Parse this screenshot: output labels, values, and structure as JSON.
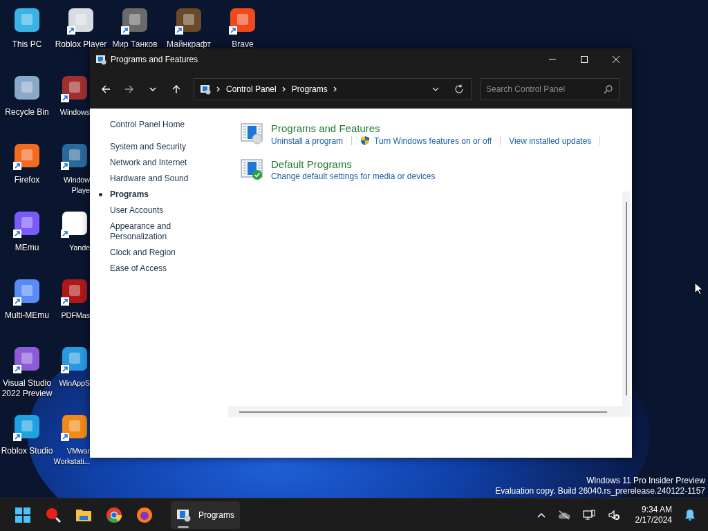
{
  "desktop": {
    "top_row": [
      {
        "label": "Мир Танков"
      },
      {
        "label": "Майнкрафт"
      },
      {
        "label": "Brave"
      }
    ],
    "icon_columns": [
      [
        {
          "label": "This PC"
        },
        {
          "label": "Recycle Bin"
        },
        {
          "label": "Firefox"
        },
        {
          "label": "MEmu"
        },
        {
          "label": "Multi-MEmu"
        },
        {
          "label": "Visual Studio 2022 Preview"
        },
        {
          "label": "Roblox Studio"
        }
      ],
      [
        {
          "label": "Roblox Player"
        },
        {
          "label": "Windows"
        },
        {
          "label": "Window Playe"
        },
        {
          "label": "Yande"
        },
        {
          "label": "PDFMas"
        },
        {
          "label": "WinAppS"
        },
        {
          "label": "VMwar Workstati..."
        }
      ]
    ],
    "watermark": [
      "Windows 11 Pro Insider Preview",
      "Evaluation copy. Build 26040.rs_prerelease.240122-1157"
    ]
  },
  "window": {
    "title": "Programs and Features",
    "breadcrumb": [
      "Control Panel",
      "Programs"
    ],
    "search": {
      "placeholder": "Search Control Panel"
    },
    "sidebar": {
      "home": "Control Panel Home",
      "items": [
        {
          "label": "System and Security",
          "selected": false
        },
        {
          "label": "Network and Internet",
          "selected": false
        },
        {
          "label": "Hardware and Sound",
          "selected": false
        },
        {
          "label": "Programs",
          "selected": true
        },
        {
          "label": "User Accounts",
          "selected": false
        },
        {
          "label": "Appearance and Personalization",
          "selected": false
        },
        {
          "label": "Clock and Region",
          "selected": false
        },
        {
          "label": "Ease of Access",
          "selected": false
        }
      ]
    },
    "sections": [
      {
        "title": "Programs and Features",
        "links": [
          {
            "label": "Uninstall a program",
            "shield": false
          },
          {
            "label": "Turn Windows features on or off",
            "shield": true
          },
          {
            "label": "View installed updates",
            "shield": false
          }
        ]
      },
      {
        "title": "Default Programs",
        "links": [
          {
            "label": "Change default settings for media or devices",
            "shield": false
          }
        ]
      }
    ]
  },
  "taskbar": {
    "running_app": {
      "label": "Programs"
    },
    "clock": {
      "time": "9:34 AM",
      "date": "2/17/2024"
    }
  }
}
